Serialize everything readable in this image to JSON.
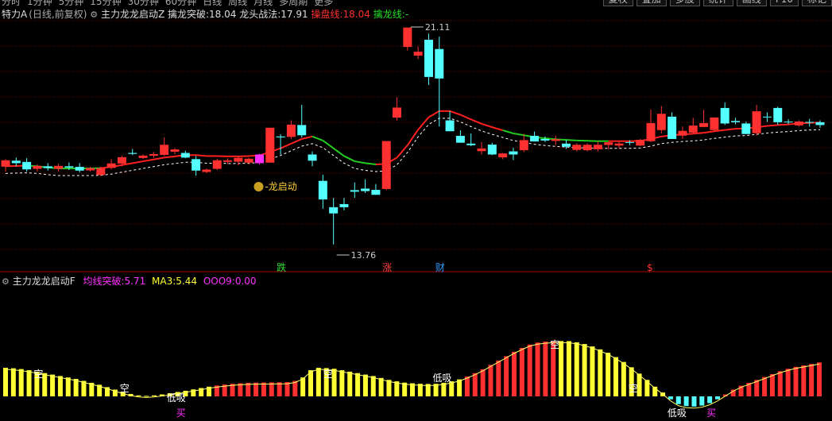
{
  "topbar": {
    "periods": [
      "分时",
      "1分钟",
      "5分钟",
      "15分钟",
      "30分钟",
      "60分钟",
      "日线",
      "周线",
      "月线",
      "多周期",
      "更多"
    ],
    "tools": [
      "复权",
      "叠加",
      "多股",
      "统计",
      "画线",
      "F10",
      "标记"
    ]
  },
  "main_header": {
    "stock": "特力A",
    "period": "(日线,前复权)",
    "indicator": "主力龙龙启动Z",
    "f1_label": "擒龙突破:",
    "f1_value": "18.04",
    "f2_label": "龙头战法:",
    "f2_value": "17.91",
    "f3_label": "操盘线:",
    "f3_value": "18.04",
    "f4_label": "擒龙线:",
    "f4_value": "-"
  },
  "sub_header": {
    "indicator": "主力龙龙启动F",
    "f1_label": "均线突破:",
    "f1_value": "5.71",
    "f2_label": "MA3:",
    "f2_value": "5.44",
    "f3_label": "OOO9:",
    "f3_value": "0.00"
  },
  "annotations": {
    "high_label": "21.11",
    "low_label": "13.76",
    "signal_label": "龙启动",
    "bottom_marks": [
      "跌",
      "涨",
      "财",
      "$"
    ]
  },
  "sub_labels": {
    "kong": "空",
    "dixi": "低吸",
    "mai": "买"
  },
  "colors": {
    "up": "#ff3030",
    "down": "#54ffff",
    "ma": "#ff2020",
    "ma_green": "#22cc22",
    "dash": "#ffffff",
    "signal": "#ff30ff",
    "yellow": "#ffff33",
    "bg": "#000000",
    "grid": "#7a0000"
  },
  "chart_data": {
    "type": "candlestick",
    "y_range": [
      13.76,
      21.11
    ],
    "candles": [
      {
        "o": 16.62,
        "h": 16.85,
        "l": 16.45,
        "c": 16.8
      },
      {
        "o": 16.8,
        "h": 16.9,
        "l": 16.62,
        "c": 16.72
      },
      {
        "o": 16.76,
        "h": 16.88,
        "l": 16.45,
        "c": 16.52
      },
      {
        "o": 16.55,
        "h": 16.68,
        "l": 16.45,
        "c": 16.62
      },
      {
        "o": 16.62,
        "h": 16.72,
        "l": 16.48,
        "c": 16.56
      },
      {
        "o": 16.55,
        "h": 16.7,
        "l": 16.45,
        "c": 16.62
      },
      {
        "o": 16.62,
        "h": 16.74,
        "l": 16.5,
        "c": 16.58
      },
      {
        "o": 16.6,
        "h": 16.72,
        "l": 16.42,
        "c": 16.48
      },
      {
        "o": 16.5,
        "h": 16.6,
        "l": 16.45,
        "c": 16.55
      },
      {
        "o": 16.35,
        "h": 16.6,
        "l": 16.3,
        "c": 16.55
      },
      {
        "o": 16.58,
        "h": 16.85,
        "l": 16.52,
        "c": 16.7
      },
      {
        "o": 16.72,
        "h": 16.96,
        "l": 16.62,
        "c": 16.9
      },
      {
        "o": 17.05,
        "h": 17.18,
        "l": 16.98,
        "c": 17.02
      },
      {
        "o": 16.9,
        "h": 17.0,
        "l": 16.85,
        "c": 16.95
      },
      {
        "o": 16.98,
        "h": 17.08,
        "l": 16.9,
        "c": 17.0
      },
      {
        "o": 17.0,
        "h": 17.55,
        "l": 16.95,
        "c": 17.3
      },
      {
        "o": 17.1,
        "h": 17.2,
        "l": 17.0,
        "c": 17.15
      },
      {
        "o": 17.05,
        "h": 17.12,
        "l": 16.88,
        "c": 16.9
      },
      {
        "o": 16.85,
        "h": 16.95,
        "l": 16.32,
        "c": 16.48
      },
      {
        "o": 16.45,
        "h": 16.55,
        "l": 16.4,
        "c": 16.5
      },
      {
        "o": 16.55,
        "h": 16.86,
        "l": 16.5,
        "c": 16.8
      },
      {
        "o": 16.78,
        "h": 16.88,
        "l": 16.7,
        "c": 16.8
      },
      {
        "o": 16.78,
        "h": 16.95,
        "l": 16.65,
        "c": 16.88
      },
      {
        "o": 16.75,
        "h": 16.9,
        "l": 16.68,
        "c": 16.85
      },
      {
        "o": 16.72,
        "h": 17.02,
        "l": 16.68,
        "c": 17.0
      },
      {
        "o": 16.75,
        "h": 17.8,
        "l": 16.75,
        "c": 17.85
      },
      {
        "o": 17.58,
        "h": 17.65,
        "l": 17.0,
        "c": 17.55
      },
      {
        "o": 17.58,
        "h": 18.1,
        "l": 17.5,
        "c": 17.95
      },
      {
        "o": 17.95,
        "h": 18.6,
        "l": 17.55,
        "c": 17.62
      },
      {
        "o": 17.0,
        "h": 17.1,
        "l": 16.62,
        "c": 16.8
      },
      {
        "o": 16.15,
        "h": 16.35,
        "l": 15.25,
        "c": 15.55
      },
      {
        "o": 15.3,
        "h": 15.6,
        "l": 14.1,
        "c": 15.1
      },
      {
        "o": 15.4,
        "h": 15.6,
        "l": 15.2,
        "c": 15.3
      },
      {
        "o": 15.85,
        "h": 16.1,
        "l": 15.6,
        "c": 15.8
      },
      {
        "o": 15.9,
        "h": 16.2,
        "l": 15.76,
        "c": 15.82
      },
      {
        "o": 15.86,
        "h": 16.05,
        "l": 15.7,
        "c": 15.7
      },
      {
        "o": 15.9,
        "h": 17.4,
        "l": 15.85,
        "c": 17.42
      },
      {
        "o": 18.2,
        "h": 18.84,
        "l": 18.1,
        "c": 18.5
      },
      {
        "o": 20.48,
        "h": 20.9,
        "l": 20.35,
        "c": 21.08
      },
      {
        "o": 20.2,
        "h": 20.48,
        "l": 20.08,
        "c": 20.3
      },
      {
        "o": 20.7,
        "h": 20.9,
        "l": 19.24,
        "c": 19.5
      },
      {
        "o": 20.4,
        "h": 20.8,
        "l": 17.9,
        "c": 19.45
      },
      {
        "o": 18.1,
        "h": 18.4,
        "l": 17.9,
        "c": 17.75
      },
      {
        "o": 17.6,
        "h": 17.78,
        "l": 17.45,
        "c": 17.38
      },
      {
        "o": 17.35,
        "h": 17.68,
        "l": 17.27,
        "c": 17.3
      },
      {
        "o": 17.12,
        "h": 17.4,
        "l": 17.0,
        "c": 17.18
      },
      {
        "o": 17.32,
        "h": 17.38,
        "l": 16.98,
        "c": 17.0
      },
      {
        "o": 16.92,
        "h": 17.05,
        "l": 16.85,
        "c": 17.02
      },
      {
        "o": 17.1,
        "h": 17.22,
        "l": 16.82,
        "c": 17.0
      },
      {
        "o": 17.15,
        "h": 17.66,
        "l": 17.08,
        "c": 17.45
      },
      {
        "o": 17.6,
        "h": 17.74,
        "l": 17.48,
        "c": 17.42
      },
      {
        "o": 17.5,
        "h": 17.58,
        "l": 17.4,
        "c": 17.45
      },
      {
        "o": 17.45,
        "h": 17.6,
        "l": 17.3,
        "c": 17.48
      },
      {
        "o": 17.35,
        "h": 17.47,
        "l": 17.18,
        "c": 17.25
      },
      {
        "o": 17.16,
        "h": 17.36,
        "l": 17.1,
        "c": 17.3
      },
      {
        "o": 17.15,
        "h": 17.36,
        "l": 17.1,
        "c": 17.3
      },
      {
        "o": 17.18,
        "h": 17.42,
        "l": 17.1,
        "c": 17.3
      },
      {
        "o": 17.32,
        "h": 17.4,
        "l": 17.16,
        "c": 17.38
      },
      {
        "o": 17.3,
        "h": 17.42,
        "l": 17.2,
        "c": 17.34
      },
      {
        "o": 17.4,
        "h": 17.46,
        "l": 17.3,
        "c": 17.38
      },
      {
        "o": 17.3,
        "h": 17.5,
        "l": 17.27,
        "c": 17.46
      },
      {
        "o": 17.44,
        "h": 18.45,
        "l": 17.4,
        "c": 18.0
      },
      {
        "o": 17.8,
        "h": 18.56,
        "l": 17.68,
        "c": 18.3
      },
      {
        "o": 18.22,
        "h": 18.36,
        "l": 18.0,
        "c": 17.5
      },
      {
        "o": 17.62,
        "h": 17.9,
        "l": 17.5,
        "c": 17.75
      },
      {
        "o": 17.72,
        "h": 18.18,
        "l": 17.66,
        "c": 17.92
      },
      {
        "o": 17.9,
        "h": 18.44,
        "l": 17.88,
        "c": 18.0
      },
      {
        "o": 17.8,
        "h": 18.2,
        "l": 17.75,
        "c": 18.18
      },
      {
        "o": 18.5,
        "h": 18.68,
        "l": 17.95,
        "c": 18.0
      },
      {
        "o": 18.08,
        "h": 18.18,
        "l": 17.97,
        "c": 18.04
      },
      {
        "o": 18.0,
        "h": 18.06,
        "l": 17.66,
        "c": 17.66
      },
      {
        "o": 17.7,
        "h": 18.6,
        "l": 17.62,
        "c": 18.38
      },
      {
        "o": 18.22,
        "h": 18.36,
        "l": 18.05,
        "c": 18.2
      },
      {
        "o": 18.5,
        "h": 18.54,
        "l": 17.96,
        "c": 18.04
      },
      {
        "o": 18.06,
        "h": 18.14,
        "l": 17.98,
        "c": 18.04
      },
      {
        "o": 17.95,
        "h": 18.1,
        "l": 17.9,
        "c": 18.05
      },
      {
        "o": 18.05,
        "h": 18.15,
        "l": 17.9,
        "c": 18.04
      },
      {
        "o": 18.04,
        "h": 18.1,
        "l": 17.86,
        "c": 17.95
      }
    ],
    "ma_line": [
      16.62,
      16.63,
      16.64,
      16.62,
      16.58,
      16.55,
      16.55,
      16.55,
      16.55,
      16.56,
      16.6,
      16.66,
      16.72,
      16.78,
      16.84,
      16.9,
      16.94,
      16.98,
      16.98,
      16.95,
      16.95,
      16.94,
      16.94,
      16.95,
      16.97,
      17.08,
      17.2,
      17.35,
      17.5,
      17.58,
      17.45,
      17.2,
      16.95,
      16.78,
      16.72,
      16.68,
      16.7,
      16.9,
      17.3,
      17.8,
      18.2,
      18.4,
      18.4,
      18.28,
      18.13,
      17.99,
      17.88,
      17.78,
      17.68,
      17.62,
      17.56,
      17.52,
      17.49,
      17.47,
      17.45,
      17.44,
      17.43,
      17.43,
      17.43,
      17.43,
      17.44,
      17.5,
      17.58,
      17.62,
      17.65,
      17.67,
      17.7,
      17.75,
      17.79,
      17.83,
      17.84,
      17.88,
      17.92,
      17.95,
      17.97,
      18.0,
      18.02,
      18.03
    ],
    "osc_values": [
      2.95,
      2.9,
      2.82,
      2.7,
      2.55,
      2.4,
      2.25,
      2.1,
      1.95,
      1.8,
      1.6,
      1.4,
      1.2,
      0.95,
      0.7,
      0.45,
      0.25,
      0.1,
      0.05,
      0.1,
      0.2,
      0.32,
      0.45,
      0.58,
      0.72,
      0.86,
      1.0,
      1.12,
      1.22,
      1.3,
      1.36,
      1.4,
      1.42,
      1.43,
      1.44,
      1.45,
      1.47,
      1.6,
      1.95,
      2.7,
      2.95,
      2.92,
      2.85,
      2.7,
      2.55,
      2.4,
      2.25,
      2.1,
      1.9,
      1.7,
      1.55,
      1.42,
      1.35,
      1.3,
      1.28,
      1.3,
      1.4,
      1.55,
      1.75,
      2.05,
      2.4,
      2.8,
      3.25,
      3.7,
      4.15,
      4.6,
      5.0,
      5.35,
      5.55,
      5.65,
      5.71,
      5.71,
      5.7,
      5.58,
      5.4,
      5.15,
      4.85,
      4.5,
      4.05,
      3.55,
      3.0,
      2.35,
      1.7,
      1.0,
      0.4,
      -0.3,
      -0.8,
      -1.0,
      -1.05,
      -0.95,
      -0.7,
      -0.3,
      0.2,
      0.7,
      1.1,
      1.4,
      1.7,
      2.0,
      2.3,
      2.6,
      2.85,
      3.05,
      3.2,
      3.35,
      3.5
    ]
  }
}
